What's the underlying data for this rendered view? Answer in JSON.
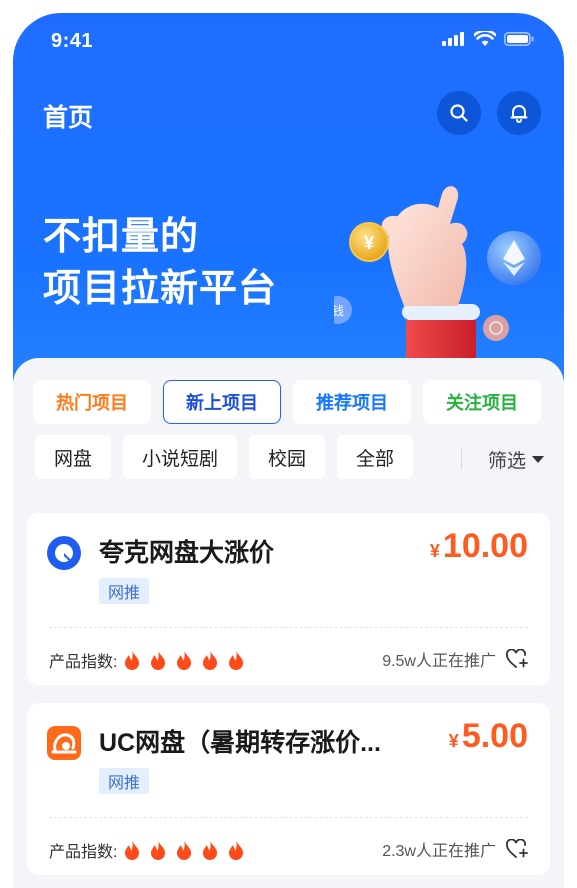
{
  "status_bar": {
    "time": "9:41"
  },
  "header": {
    "title": "首页"
  },
  "hero": {
    "headline_line1": "不扣量的",
    "headline_line2": "项目拉新平台"
  },
  "tabs": [
    {
      "label": "热门项目",
      "color": "#ff7a1a",
      "active": false
    },
    {
      "label": "新上项目",
      "color": "#1d4fd8",
      "active": true
    },
    {
      "label": "推荐项目",
      "color": "#1677ff",
      "active": false
    },
    {
      "label": "关注项目",
      "color": "#26b23e",
      "active": false
    }
  ],
  "chips": [
    "网盘",
    "小说短剧",
    "校园",
    "全部"
  ],
  "filter": {
    "label": "筛选"
  },
  "projects": [
    {
      "name": "夸克网盘大涨价",
      "currency": "¥",
      "price": "10.00",
      "tag": "网推",
      "index_label": "产品指数:",
      "index_value": 5,
      "promoters": "9.5w人正在推广",
      "logo": "quark-logo-icon"
    },
    {
      "name": "UC网盘（暑期转存涨价...",
      "currency": "¥",
      "price": "5.00",
      "tag": "网推",
      "index_label": "产品指数:",
      "index_value": 5,
      "promoters": "2.3w人正在推广",
      "logo": "uc-logo-icon"
    }
  ],
  "colors": {
    "brand_blue": "#1a73ff",
    "price_orange": "#ff5a1f",
    "flame": "#ff4a1a"
  }
}
